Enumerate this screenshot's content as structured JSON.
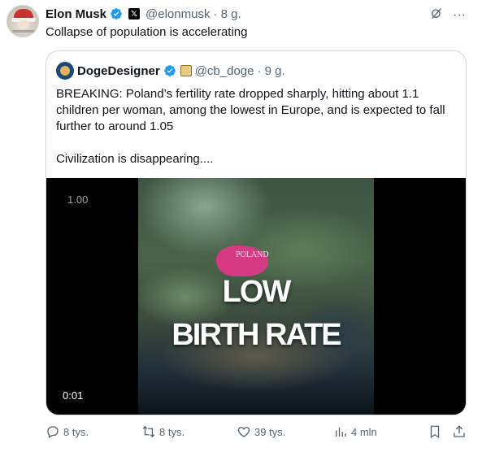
{
  "author": {
    "name": "Elon Musk",
    "handle": "@elonmusk",
    "time": "· 8 g."
  },
  "post": {
    "text": "Collapse of population is accelerating"
  },
  "top_icons": [
    "grok-icon",
    "more-icon"
  ],
  "quote": {
    "name": "DogeDesigner",
    "handle": "@cb_doge",
    "time": "· 9 g.",
    "text": "BREAKING: Poland’s fertility rate dropped sharply, hitting about 1.1 children per woman, among the lowest in Europe, and is expected to fall further to around 1.05",
    "text2": "Civilization is disappearing....",
    "video": {
      "speed": "1.00",
      "map_label": "POLAND",
      "overlay_line1": "LOW",
      "overlay_line2": "BIRTH RATE",
      "timecode": "0:01"
    }
  },
  "actions": {
    "replies": "8 tys.",
    "reposts": "8 tys.",
    "likes": "39 tys.",
    "views": "4 mln"
  },
  "colors": {
    "accent": "#1d9bf0",
    "muted": "#536471",
    "highlight": "#d63a83"
  }
}
